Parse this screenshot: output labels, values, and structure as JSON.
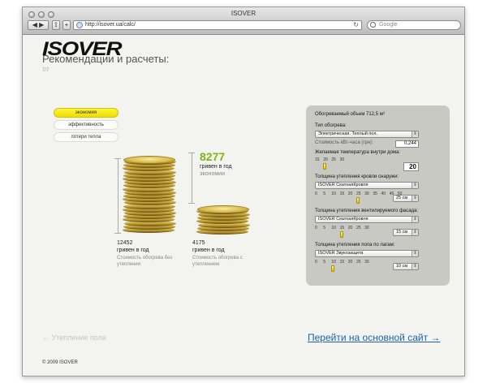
{
  "browser": {
    "window_title": "ISOVER",
    "url": "http://isover.ua/calc/",
    "search_placeholder": "Google"
  },
  "page": {
    "logo_text": "ISOVER",
    "title": "Рекомендации и расчеты:",
    "counter": "7/7"
  },
  "tabs": [
    {
      "label": "экономия",
      "active": true
    },
    {
      "label": "эффективность",
      "active": false
    },
    {
      "label": "потери тепла",
      "active": false
    }
  ],
  "results": {
    "savings_value": "8277",
    "savings_unit": "гривен в год",
    "savings_caption": "экономии",
    "without": {
      "value": "12452",
      "unit": "гривен в год",
      "caption": "Стоимость обогрева без утепления"
    },
    "with": {
      "value": "4175",
      "unit": "гривен в год",
      "caption": "Стоимость обогрева с утеплением"
    }
  },
  "calculator": {
    "volume_label": "Обогреваемый объем 712,5 м³",
    "heating_type_label": "Тип обогрева:",
    "heating_type_value": "Электрическая. Теплый пол.",
    "cost_label": "Стоимость кВт-часа (грн):",
    "cost_value": "0,244",
    "temperature_label": "Желаемая температура внутри дома:",
    "temperature_ticks": [
      "15",
      "20",
      "25",
      "30"
    ],
    "temperature_value": "20",
    "temperature_position": 0.33,
    "roof_label": "Толщина утепления кровли снаружи:",
    "roof_material": "ISOVER СкатнаяКровля",
    "roof_ticks": [
      "0",
      "5",
      "10",
      "15",
      "20",
      "25",
      "30",
      "35",
      "40",
      "45",
      "50"
    ],
    "roof_thickness": "25 см",
    "roof_position": 0.5,
    "facade_label": "Толщина утепления вентилируемого фасада:",
    "facade_material": "ISOVER СкатнаяКровля",
    "facade_ticks": [
      "0",
      "5",
      "10",
      "15",
      "20",
      "25",
      "30"
    ],
    "facade_thickness": "15 см",
    "facade_position": 0.5,
    "floor_label": "Толщина утепления пола по лагам:",
    "floor_material": "ISOVER Звукозащита",
    "floor_ticks": [
      "0",
      "5",
      "10",
      "15",
      "20",
      "25",
      "30"
    ],
    "floor_thickness": "10 см",
    "floor_position": 0.33
  },
  "footer": {
    "back_link": "←  Утепление пола",
    "main_link": "Перейти на основной сайт  →",
    "copyright": "© 2009 ISOVER"
  }
}
